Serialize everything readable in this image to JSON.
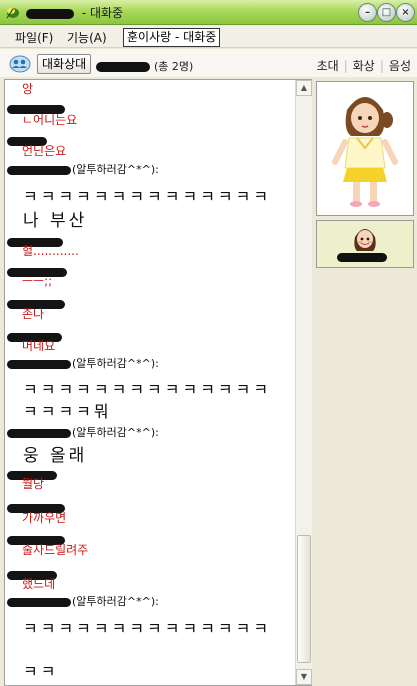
{
  "window": {
    "title_suffix": " - 대화중",
    "minimize_glyph": "–",
    "maximize_glyph": "□",
    "close_glyph": "×"
  },
  "menu": {
    "items": [
      "파일(F)",
      "기능(A)"
    ],
    "tooltip": "훈이사랑 - 대화중"
  },
  "toolbar": {
    "status_button": "대화상대",
    "members": "(총 2명)",
    "invite": "초대",
    "video": "화상",
    "voice": "음성"
  },
  "chat": {
    "messages": [
      {
        "kind": "red",
        "text": "앙"
      },
      {
        "kind": "red",
        "text": "ㄴ어니는요"
      },
      {
        "kind": "red",
        "text": "언닌은요"
      },
      {
        "kind": "nick",
        "note": "(알투하러감^*^):"
      },
      {
        "kind": "big",
        "text": "ㅋㅋㅋㅋㅋㅋㅋㅋㅋㅋㅋㅋㅋㅋ"
      },
      {
        "kind": "big2",
        "text": "나 부산"
      },
      {
        "kind": "red",
        "text": "헐............"
      },
      {
        "kind": "red",
        "text": "ㅡㅡ;;"
      },
      {
        "kind": "red",
        "text": "존나"
      },
      {
        "kind": "red",
        "text": "머네요"
      },
      {
        "kind": "nick",
        "note": "(알투하러감^*^):"
      },
      {
        "kind": "big",
        "text": "ㅋㅋㅋㅋㅋㅋㅋㅋㅋㅋㅋㅋㅋㅋ"
      },
      {
        "kind": "big",
        "text": "ㅋㅋㅋㅋ뭐"
      },
      {
        "kind": "nick",
        "note": "(알투하러감^*^):"
      },
      {
        "kind": "big2",
        "text": "웅 올래"
      },
      {
        "kind": "red",
        "text": "뭘당"
      },
      {
        "kind": "red",
        "text": "가까우면"
      },
      {
        "kind": "red",
        "text": "술사드릴려주"
      },
      {
        "kind": "red",
        "text": "했느데"
      },
      {
        "kind": "nick",
        "note": "(알투하러감^*^):"
      },
      {
        "kind": "big",
        "text": "ㅋㅋㅋㅋㅋㅋㅋㅋㅋㅋㅋㅋㅋㅋ"
      },
      {
        "kind": "big",
        "text": "ㅋㅋ"
      }
    ]
  },
  "colors": {
    "title_green": "#8cc63f",
    "message_red": "#c81818"
  },
  "icons": [
    "app-leaf-icon",
    "people-chat-icon",
    "scroll-up-icon",
    "scroll-down-icon"
  ]
}
